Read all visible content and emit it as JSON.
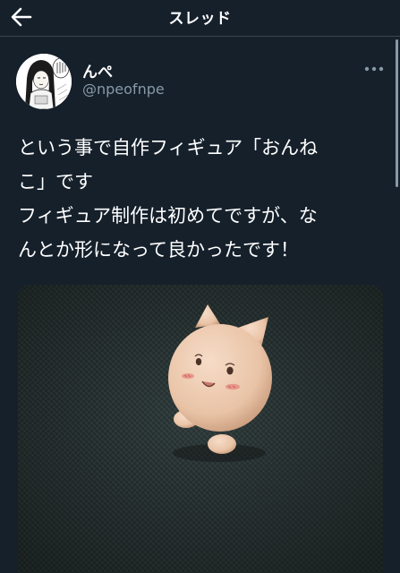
{
  "header": {
    "title": "スレッド",
    "back_icon": "arrow-left-icon"
  },
  "tweet": {
    "author": {
      "display_name": "んぺ",
      "handle": "@npeofnpe"
    },
    "more_icon": "more-horizontal-icon",
    "text_lines": [
      "という事で自作フィギュア「おんね",
      "こ」です",
      "フィギュア制作は初めてですが、な",
      "んとか形になって良かったです！"
    ]
  },
  "colors": {
    "background": "#15202b",
    "divider": "#38444d",
    "secondary_text": "#8899a6",
    "primary_text": "#ffffff"
  }
}
